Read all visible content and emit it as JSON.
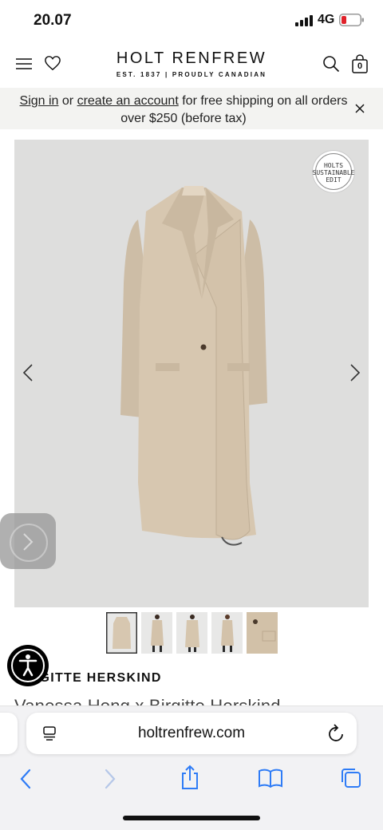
{
  "status": {
    "time": "20.07",
    "network": "4G"
  },
  "header": {
    "brand": "HOLT RENFREW",
    "tagline": "EST. 1837 | PROUDLY CANADIAN",
    "bag_count": "0"
  },
  "banner": {
    "sign_in": "Sign in",
    "or": " or ",
    "create_account": "create an account",
    "rest": " for free shipping on all orders over $250 (before tax)"
  },
  "gallery": {
    "badge_lines": [
      "HOLTS",
      "SUSTAINABLE",
      "EDIT"
    ],
    "thumbnail_count": 5,
    "selected_thumbnail": 1
  },
  "product": {
    "brand": "BIRGITTE HERSKIND",
    "name": "Vanessa Hong x Birgitte Herskind"
  },
  "browser": {
    "url": "holtrenfrew.com"
  },
  "colors": {
    "coat": "#d7c7b0",
    "image_bg": "#dededd",
    "accent": "#111111"
  }
}
